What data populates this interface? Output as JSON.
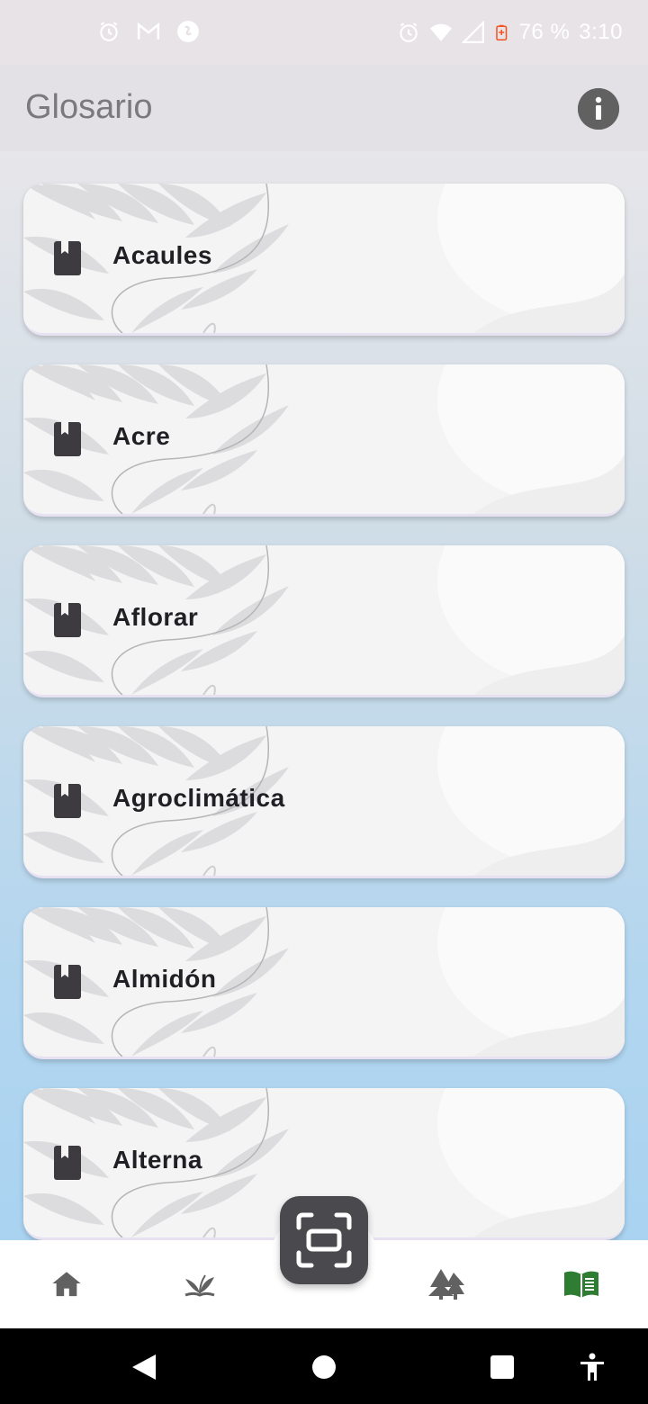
{
  "status_bar": {
    "left_icons": [
      "alarm-icon",
      "gmail-icon",
      "shazam-icon"
    ],
    "right_icons": [
      "alarm-icon",
      "wifi-icon",
      "signal-icon",
      "battery-charging-icon"
    ],
    "battery": "76 %",
    "time": "3:10"
  },
  "app_bar": {
    "title": "Glosario",
    "info_icon": "info-icon"
  },
  "glossary": {
    "items": [
      {
        "label": "Acaules",
        "icon": "book-icon"
      },
      {
        "label": "Acre",
        "icon": "book-icon"
      },
      {
        "label": "Aflorar",
        "icon": "book-icon"
      },
      {
        "label": "Agroclimática",
        "icon": "book-icon"
      },
      {
        "label": "Almidón",
        "icon": "book-icon"
      },
      {
        "label": "Alterna",
        "icon": "book-icon"
      }
    ]
  },
  "bottom_nav": {
    "items": [
      {
        "icon": "home-icon",
        "active": false
      },
      {
        "icon": "plant-icon",
        "active": false
      },
      {
        "icon": "scan-icon",
        "active": false
      },
      {
        "icon": "trees-icon",
        "active": false
      },
      {
        "icon": "glossary-book-icon",
        "active": true
      }
    ],
    "active_color": "#2e7d32",
    "inactive_color": "#616161"
  },
  "system_nav": [
    "back-icon",
    "home-circle-icon",
    "recents-icon",
    "accessibility-icon"
  ]
}
